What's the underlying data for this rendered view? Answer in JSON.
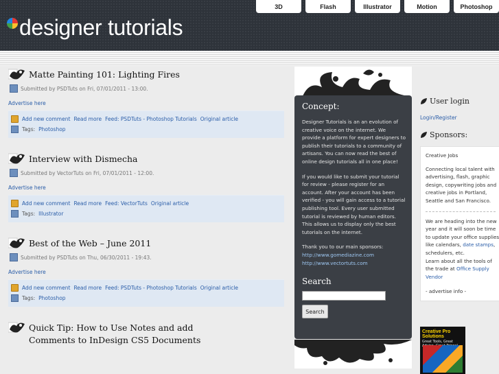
{
  "brand": {
    "title": "designer tutorials"
  },
  "nav": {
    "tabs": [
      "3D",
      "Flash",
      "Illustrator",
      "Motion",
      "Photoshop"
    ]
  },
  "posts": [
    {
      "title": "Matte Painting 101: Lighting Fires",
      "meta": "Submitted by PSDTuts on Fri, 07/01/2011 - 13:00.",
      "advertise": "Advertise here",
      "links": [
        "Add new comment",
        "Read more",
        "Feed: PSDTuts - Photoshop Tutorials",
        "Original article"
      ],
      "tags_label": "Tags:",
      "tag": "Photoshop"
    },
    {
      "title": "Interview with Dismecha",
      "meta": "Submitted by VectorTuts on Fri, 07/01/2011 - 12:00.",
      "advertise": "Advertise here",
      "links": [
        "Add new comment",
        "Read more",
        "Feed: VectorTuts",
        "Original article"
      ],
      "tags_label": "Tags:",
      "tag": "Illustrator"
    },
    {
      "title": "Best of the Web – June 2011",
      "meta": "Submitted by PSDTuts on Thu, 06/30/2011 - 19:43.",
      "advertise": "Advertise here",
      "links": [
        "Add new comment",
        "Read more",
        "Feed: PSDTuts - Photoshop Tutorials",
        "Original article"
      ],
      "tags_label": "Tags:",
      "tag": "Photoshop"
    },
    {
      "title": "Quick Tip: How to Use Notes and add Comments to InDesign CS5 Documents"
    }
  ],
  "concept": {
    "heading": "Concept:",
    "p1": "Designer Tutorials is an an evolution of creative voice on the internet. We provide a platform for expert designers to publish their tutorials to a community of artisans. You can now read the best of online design tutorials all in one place!",
    "p2": "If you would like to submit your tutorial for review - please register for an account. After your account has been verified - you will gain access to a tutorial publishing tool. Every user submitted tutorial is reviewed by human editors. This allows us to display only the best tutorials on the internet.",
    "p3": "Thank you to our main sponsors:",
    "sponsor1": "http://www.gomediazine.com",
    "sponsor2": "http://www.vectortuts.com",
    "search_heading": "Search",
    "search_button": "Search"
  },
  "sidebar": {
    "login_heading": "User login",
    "login_link": "Login/Register",
    "sponsors_heading": "Sponsors:",
    "sponsor_link": "Creative Jobs",
    "sponsor_text": "Connecting local talent with advertising, flash, graphic design, copywriting jobs and creative jobs in Portland, Seattle and San Francisco.",
    "office_text_a": "We are heading into the new year and it will soon be time to update your office supplies like calendars,",
    "office_link_a": "date stamps",
    "office_text_b": ", schedulers, etc.",
    "office_text_c": "Learn about all the tools of the trade at",
    "office_link_b": "Office Supply Vendor",
    "advertise_info": "- advertise info -",
    "ad_title": "Creative Pro Solutions",
    "ad_sub": "Great Tools, Great Advice, Great Prices!"
  },
  "colors": {
    "header": "#2e333a",
    "link": "#2a5da8",
    "concept_box": "#3b3f45",
    "links_bg": "#dfe8f3"
  }
}
